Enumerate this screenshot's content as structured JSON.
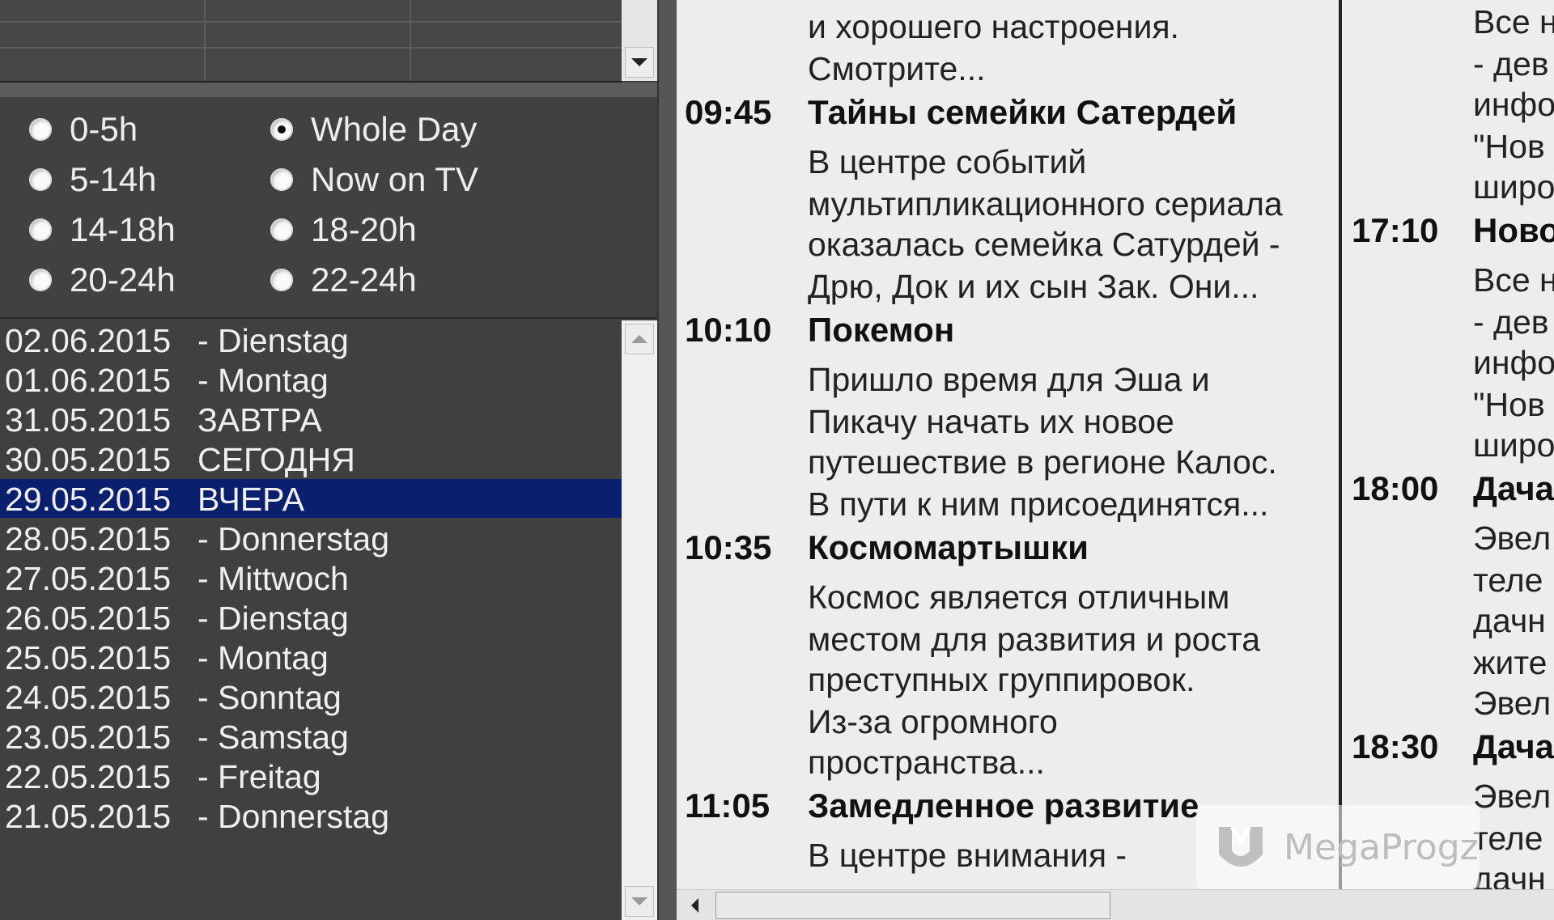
{
  "time_filters": {
    "options": [
      "0-5h",
      "Whole Day",
      "5-14h",
      "Now on TV",
      "14-18h",
      "18-20h",
      "20-24h",
      "22-24h"
    ],
    "selected": "Whole Day"
  },
  "dates": [
    {
      "date": "02.06.2015",
      "label": "- Dienstag"
    },
    {
      "date": "01.06.2015",
      "label": "- Montag"
    },
    {
      "date": "31.05.2015",
      "label": "ЗАВТРА"
    },
    {
      "date": "30.05.2015",
      "label": "СЕГОДНЯ"
    },
    {
      "date": "29.05.2015",
      "label": "ВЧЕРА"
    },
    {
      "date": "28.05.2015",
      "label": "- Donnerstag"
    },
    {
      "date": "27.05.2015",
      "label": "- Mittwoch"
    },
    {
      "date": "26.05.2015",
      "label": "- Dienstag"
    },
    {
      "date": "25.05.2015",
      "label": "- Montag"
    },
    {
      "date": "24.05.2015",
      "label": "- Sonntag"
    },
    {
      "date": "23.05.2015",
      "label": "- Samstag"
    },
    {
      "date": "22.05.2015",
      "label": "- Freitag"
    },
    {
      "date": "21.05.2015",
      "label": "- Donnerstag"
    }
  ],
  "selected_date": "29.05.2015",
  "schedule_left": {
    "top_desc": [
      "и хорошего настроения.",
      "Смотрите..."
    ],
    "programs": [
      {
        "time": "09:45",
        "title": "Тайны семейки Сатердей",
        "desc": [
          "В центре событий",
          "мультипликационного сериала",
          "оказалась семейка Сатурдей -",
          "Дрю, Док и их сын Зак. Они..."
        ]
      },
      {
        "time": "10:10",
        "title": "Покемон",
        "desc": [
          "Пришло время для Эша и",
          "Пикачу начать их новое",
          "путешествие в регионе Калос.",
          "В пути к ним присоединятся..."
        ]
      },
      {
        "time": "10:35",
        "title": "Космомартышки",
        "desc": [
          "Космос является отличным",
          "местом для развития и роста",
          "преступных группировок.",
          "Из-за огромного",
          "пространства..."
        ]
      },
      {
        "time": "11:05",
        "title": "Замедленное развитие",
        "desc": [
          "В центре внимания -"
        ]
      }
    ]
  },
  "schedule_right": {
    "top_desc": [
      "Все н",
      "- дев",
      "инфо",
      "\"Нов",
      "широ"
    ],
    "programs": [
      {
        "time": "17:10",
        "title": "Ново",
        "desc": [
          "Все н",
          "- дев",
          "инфо",
          "\"Нов",
          "широ"
        ]
      },
      {
        "time": "18:00",
        "title": "Дача",
        "desc": [
          "Эвел",
          "теле",
          "дачн",
          "жите",
          "Эвел"
        ]
      },
      {
        "time": "18:30",
        "title": "Дача",
        "desc": [
          "Эвел",
          "теле",
          "дачн"
        ]
      }
    ]
  },
  "watermark": {
    "text": "MegaProgz",
    "icon": "megaprogz-logo-icon"
  },
  "colors": {
    "selection": "#0a1f6e",
    "panel_bg": "#404040",
    "schedule_bg": "#ededed"
  }
}
